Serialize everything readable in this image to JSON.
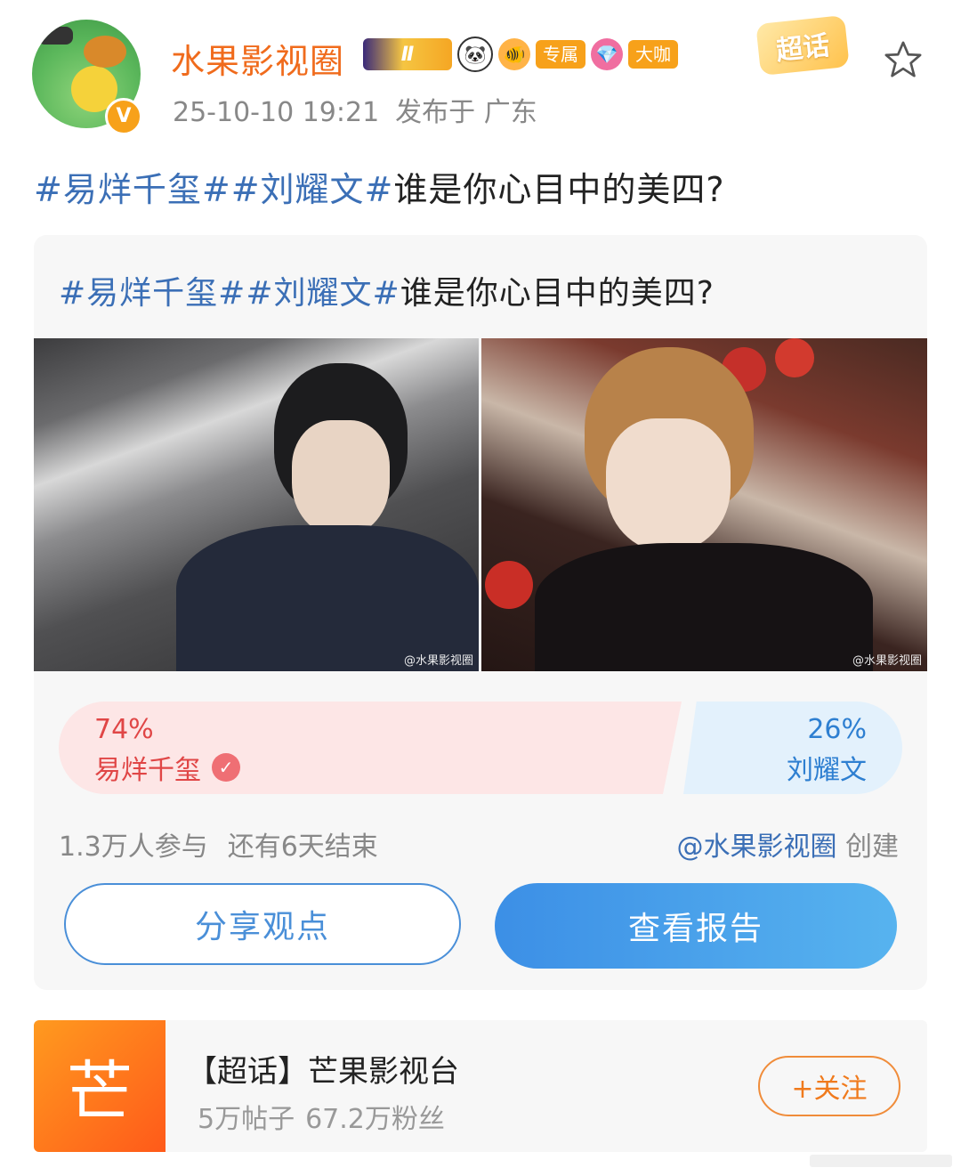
{
  "header": {
    "username": "水果影视圈",
    "level_badge": "Ⅱ",
    "badge_exclusive": "专属",
    "badge_daka": "大咖",
    "supertopic_badge": "超话",
    "timestamp": "25-10-10 19:21",
    "published_from": "发布于 广东",
    "verified_mark": "V"
  },
  "post": {
    "tag1": "#易烊千玺#",
    "tag2": "#刘耀文#",
    "question": "谁是你心目中的美四?"
  },
  "poll": {
    "title_tag1": "#易烊千玺#",
    "title_tag2": "#刘耀文#",
    "title_question": "谁是你心目中的美四?",
    "watermark": "@水果影视圈",
    "option_left": {
      "name": "易烊千玺",
      "percent": "74%",
      "value": 0.74,
      "color": "#e04646"
    },
    "option_right": {
      "name": "刘耀文",
      "percent": "26%",
      "value": 0.26,
      "color": "#2e7fd1"
    },
    "participants": "1.3万人参与",
    "remaining": "还有6天结束",
    "creator_at": "@水果影视圈",
    "creator_suffix": "创建",
    "share_label": "分享观点",
    "report_label": "查看报告"
  },
  "supertopic": {
    "logo_char": "芒",
    "name": "【超话】芒果影视台",
    "posts": "5万帖子",
    "fans": "67.2万粉丝",
    "follow_label": "+关注"
  },
  "colors": {
    "username": "#f06b1c",
    "hashtag": "#3b6fb6",
    "report_button": "#3c8fe6"
  }
}
